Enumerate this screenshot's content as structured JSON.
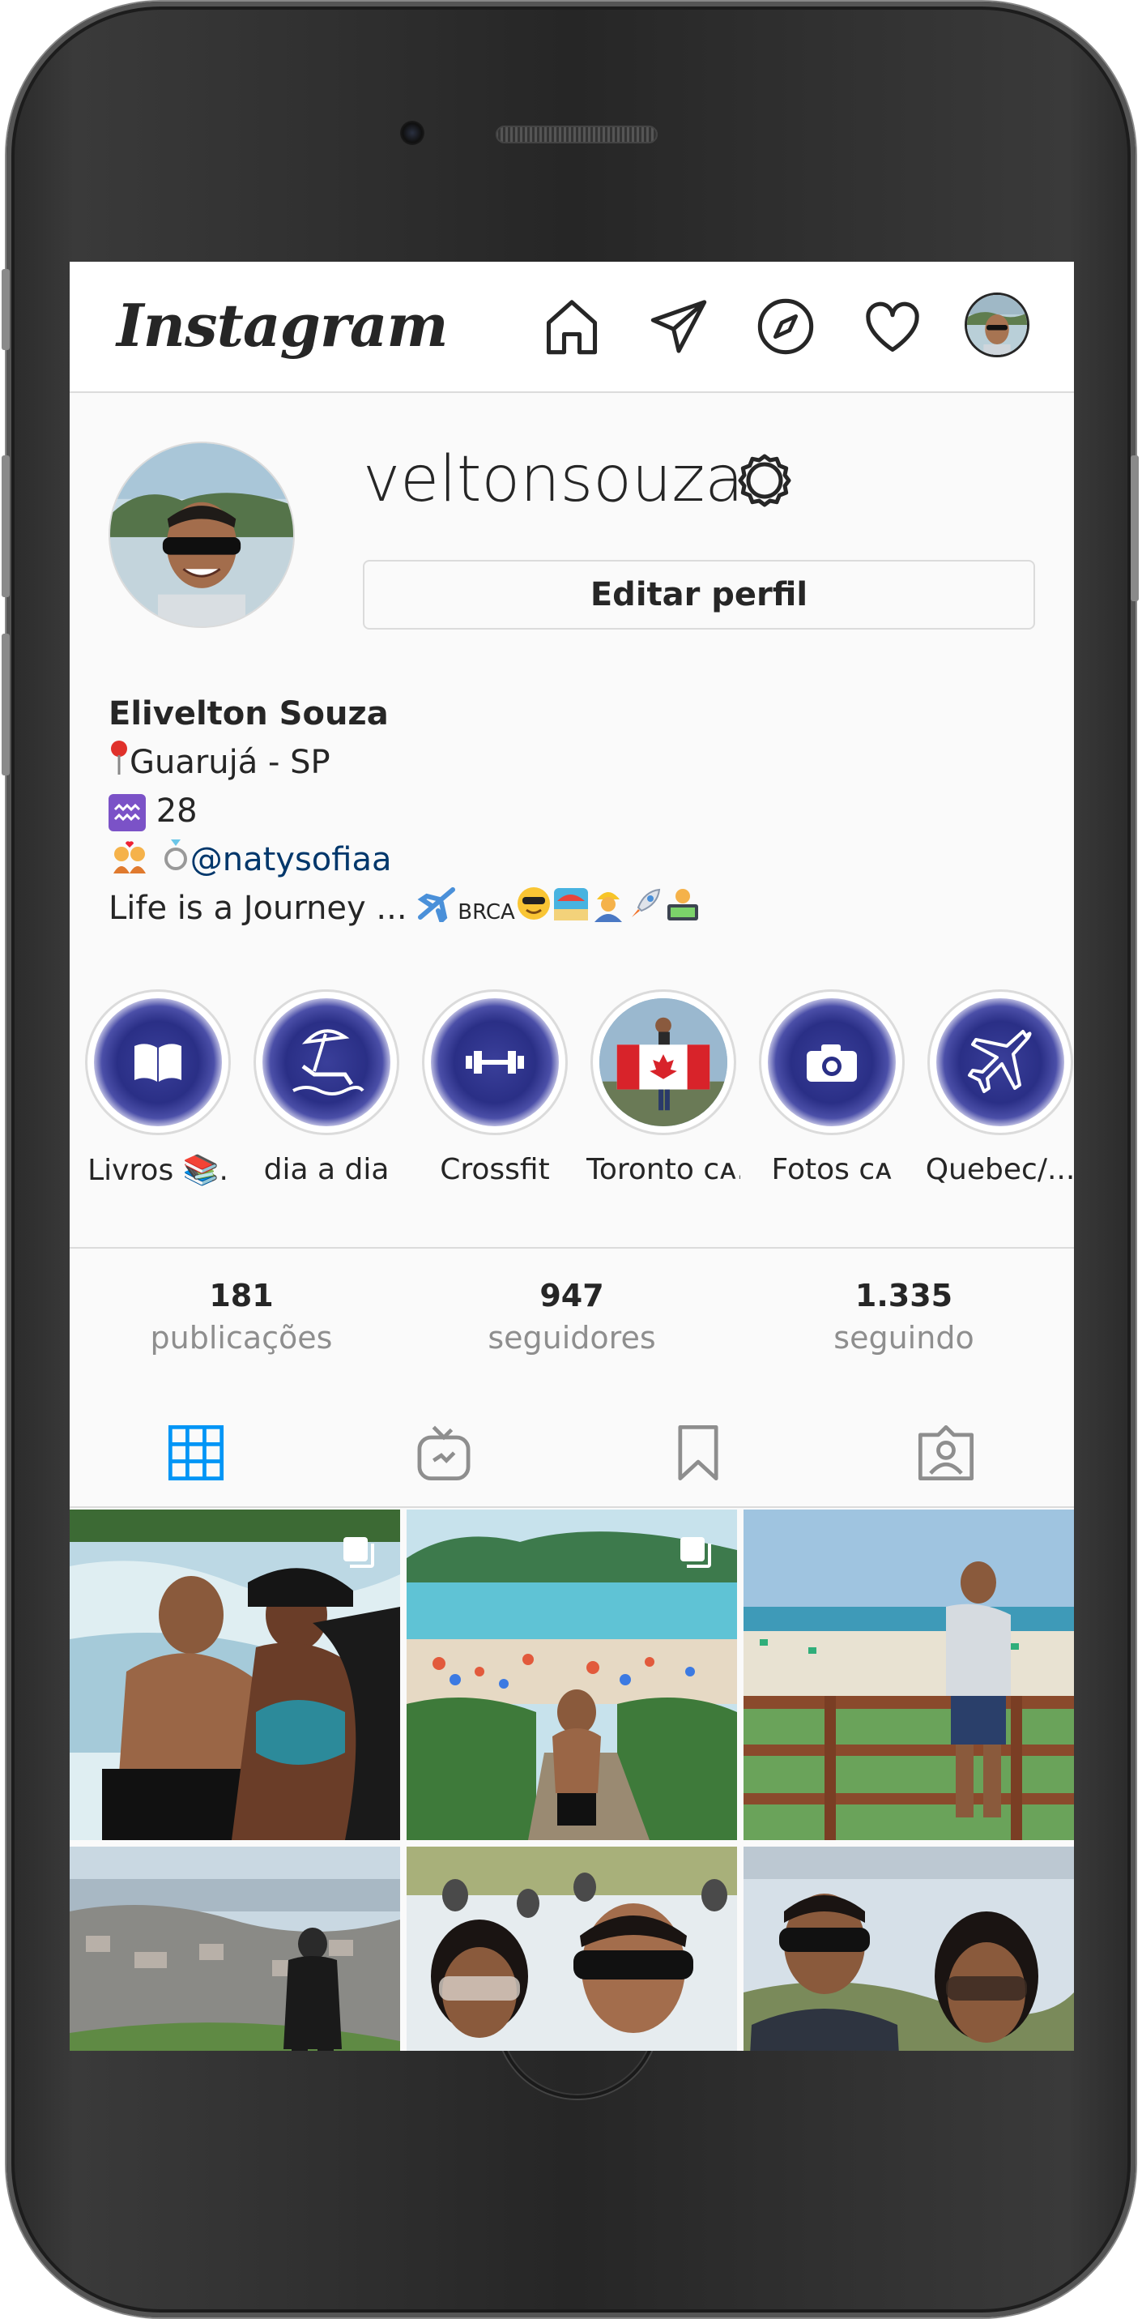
{
  "app": {
    "logo": "Instagram"
  },
  "nav": {
    "icons": [
      "home-icon",
      "direct-icon",
      "explore-icon",
      "activity-heart-icon",
      "profile-avatar"
    ]
  },
  "profile": {
    "username": "veltonsouza",
    "edit_label": "Editar perfil",
    "name": "Elivelton Souza",
    "bio_location": "Guarujá - SP",
    "bio_age": "28",
    "bio_mention": "@natysofiaa",
    "bio_tagline": "Life is a Journey ...",
    "bio_tagline_caps": "BRCA"
  },
  "highlights": [
    {
      "label": "Livros 📚.",
      "icon": "book-icon"
    },
    {
      "label": "dia a dia",
      "icon": "beach-chair-icon"
    },
    {
      "label": "Crossfit",
      "icon": "dumbbell-icon"
    },
    {
      "label": "Toronto ᴄᴀ...",
      "icon": "photo"
    },
    {
      "label": "Fotos ᴄᴀ",
      "icon": "camera-icon"
    },
    {
      "label": "Quebec/...",
      "icon": "airplane-icon"
    }
  ],
  "stats": {
    "posts_count": "181",
    "posts_label": "publicações",
    "followers_count": "947",
    "followers_label": "seguidores",
    "following_count": "1.335",
    "following_label": "seguindo"
  },
  "tabs": [
    "grid-icon",
    "igtv-icon",
    "saved-icon",
    "tagged-icon"
  ],
  "colors": {
    "active_tab": "#0095f6",
    "link": "#00376b",
    "highlight_blue": "#2a2f86"
  }
}
